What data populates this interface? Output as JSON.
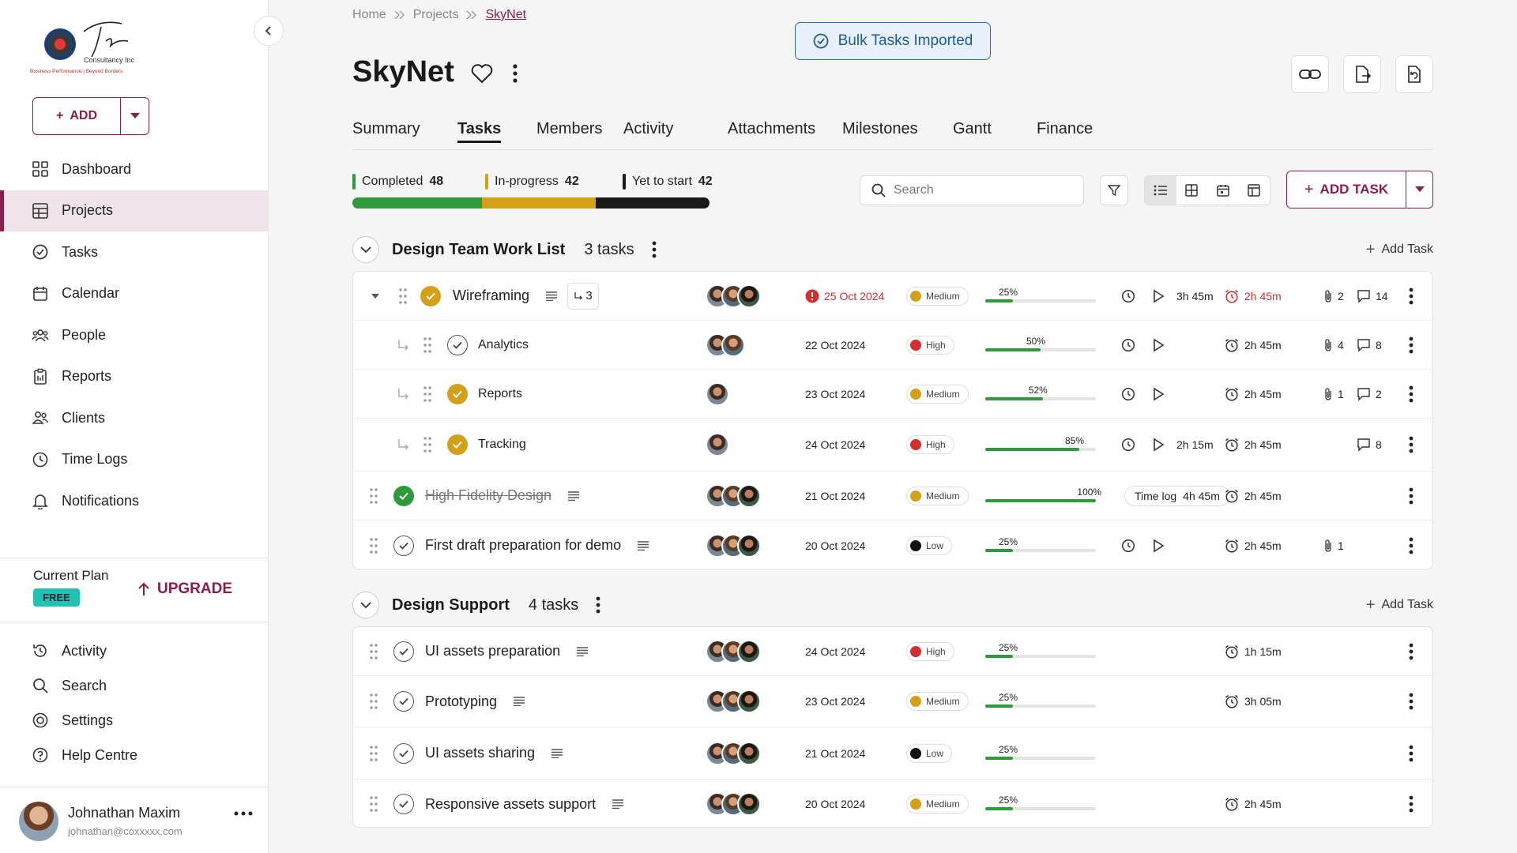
{
  "sidebar": {
    "logo_text": "The Consultancy Inc",
    "logo_tagline": "Business Performance | Beyond Borders",
    "add_label": "ADD",
    "nav": [
      {
        "label": "Dashboard",
        "icon": "grid-icon"
      },
      {
        "label": "Projects",
        "icon": "table-icon",
        "active": true
      },
      {
        "label": "Tasks",
        "icon": "check-circle-icon"
      },
      {
        "label": "Calendar",
        "icon": "calendar-icon"
      },
      {
        "label": "People",
        "icon": "people-icon"
      },
      {
        "label": "Reports",
        "icon": "clipboard-icon"
      },
      {
        "label": "Clients",
        "icon": "clients-icon"
      },
      {
        "label": "Time Logs",
        "icon": "clock-icon"
      },
      {
        "label": "Notifications",
        "icon": "bell-icon"
      }
    ],
    "plan": {
      "label": "Current Plan",
      "badge": "FREE",
      "upgrade": "UPGRADE"
    },
    "nav2": [
      {
        "label": "Activity",
        "icon": "history-icon"
      },
      {
        "label": "Search",
        "icon": "search-icon"
      },
      {
        "label": "Settings",
        "icon": "settings-icon"
      },
      {
        "label": "Help Centre",
        "icon": "help-icon"
      }
    ],
    "user": {
      "name": "Johnathan Maxim",
      "email": "johnathan@coxxxxx.com"
    }
  },
  "breadcrumb": {
    "home": "Home",
    "projects": "Projects",
    "current": "SkyNet"
  },
  "toast": "Bulk Tasks Imported",
  "project": {
    "title": "SkyNet"
  },
  "tabs": [
    "Summary",
    "Tasks",
    "Members",
    "Activity",
    "Attachments",
    "Milestones",
    "Gantt",
    "Finance"
  ],
  "active_tab": "Tasks",
  "status": {
    "completed": {
      "label": "Completed",
      "count": "48",
      "value": 48,
      "color": "#2e9a3b"
    },
    "inprogress": {
      "label": "In-progress",
      "count": "42",
      "value": 42,
      "color": "#d4a017"
    },
    "yet": {
      "label": "Yet to start",
      "count": "42",
      "value": 42,
      "color": "#1a1a1a"
    }
  },
  "search": {
    "placeholder": "Search"
  },
  "add_task_label": "ADD TASK",
  "add_task_inline": "Add Task",
  "colors": {
    "accent": "#8b1d4b",
    "high": "#d32f2f",
    "medium": "#d4a017",
    "low": "#111111",
    "progress": "#2e9a3b"
  },
  "groups": [
    {
      "title": "Design Team Work List",
      "count": "3 tasks",
      "tasks": [
        {
          "name": "Wireframing",
          "level": 0,
          "expand": true,
          "check": "gold",
          "desc": true,
          "subtasks": "3",
          "avatars": 3,
          "date": "25 Oct 2024",
          "overdue": true,
          "priority": "Medium",
          "progress": 25,
          "progress_label": "25%",
          "clock": true,
          "play": true,
          "logged": "3h 45m",
          "estimate": "2h 45m",
          "estimate_red": true,
          "attachments": "2",
          "comments": "14"
        },
        {
          "name": "Analytics",
          "level": 1,
          "check": "outline",
          "avatars": 2,
          "date": "22 Oct 2024",
          "priority": "High",
          "progress": 50,
          "progress_label": "50%",
          "clock": true,
          "play": true,
          "logged": "",
          "estimate": "2h 45m",
          "attachments": "4",
          "comments": "8"
        },
        {
          "name": "Reports",
          "level": 1,
          "check": "gold",
          "avatars": 1,
          "date": "23 Oct 2024",
          "priority": "Medium",
          "progress": 52,
          "progress_label": "52%",
          "clock": true,
          "play": true,
          "logged": "",
          "estimate": "2h 45m",
          "attachments": "1",
          "comments": "2"
        },
        {
          "name": "Tracking",
          "level": 1,
          "check": "gold",
          "avatars": 1,
          "date": "24 Oct 2024",
          "priority": "High",
          "progress": 85,
          "progress_label": "85%",
          "clock": true,
          "play": true,
          "logged": "2h 15m",
          "estimate": "2h 45m",
          "attachments": "",
          "comments": "8"
        },
        {
          "name": "High Fidelity Design",
          "level": 0,
          "check": "green",
          "done": true,
          "desc": true,
          "avatars": 3,
          "date": "21 Oct 2024",
          "priority": "Medium",
          "progress": 100,
          "progress_label": "100%",
          "timelog_chip": {
            "label": "Time log",
            "value": "4h 45m"
          },
          "estimate": "2h 45m",
          "attachments": "",
          "comments": ""
        },
        {
          "name": "First draft preparation for demo",
          "level": 0,
          "check": "outline",
          "desc": true,
          "avatars": 3,
          "date": "20 Oct 2024",
          "priority": "Low",
          "progress": 25,
          "progress_label": "25%",
          "clock": true,
          "play": true,
          "logged": "",
          "estimate": "2h 45m",
          "attachments": "1",
          "comments": ""
        }
      ]
    },
    {
      "title": "Design Support",
      "count": "4 tasks",
      "tasks": [
        {
          "name": "UI assets preparation",
          "level": 0,
          "check": "outline",
          "desc": true,
          "avatars": 3,
          "date": "24 Oct 2024",
          "priority": "High",
          "progress": 25,
          "progress_label": "25%",
          "estimate": "1h 15m",
          "attachments": "",
          "comments": ""
        },
        {
          "name": "Prototyping",
          "level": 0,
          "check": "outline",
          "desc": true,
          "avatars": 3,
          "date": "23 Oct 2024",
          "priority": "Medium",
          "progress": 25,
          "progress_label": "25%",
          "estimate": "3h 05m",
          "attachments": "",
          "comments": ""
        },
        {
          "name": "UI assets sharing",
          "level": 0,
          "check": "outline",
          "desc": true,
          "avatars": 3,
          "date": "21 Oct 2024",
          "priority": "Low",
          "progress": 25,
          "progress_label": "25%",
          "estimate": "",
          "attachments": "",
          "comments": ""
        },
        {
          "name": "Responsive assets support",
          "level": 0,
          "check": "outline",
          "desc": true,
          "avatars": 3,
          "date": "20 Oct 2024",
          "priority": "Medium",
          "progress": 25,
          "progress_label": "25%",
          "estimate": "2h 45m",
          "attachments": "",
          "comments": ""
        }
      ]
    }
  ]
}
